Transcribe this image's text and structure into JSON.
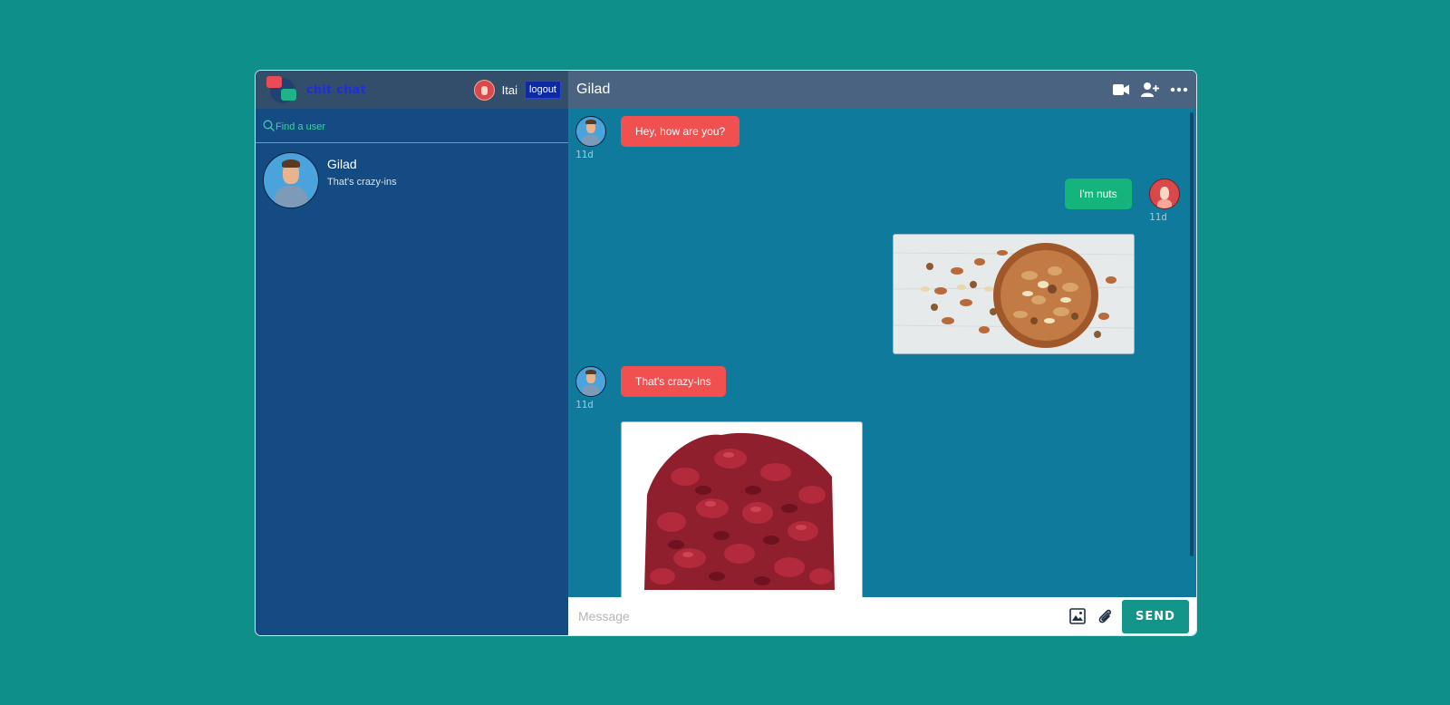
{
  "app": {
    "brand": "chit chat"
  },
  "user": {
    "name": "Itai",
    "logout_label": "logout"
  },
  "search": {
    "placeholder": "Find a user"
  },
  "contacts": [
    {
      "name": "Gilad",
      "preview": "That's crazy-ins"
    }
  ],
  "chat": {
    "title": "Gilad",
    "messages": [
      {
        "from": "them",
        "kind": "text",
        "text": "Hey, how are you?",
        "time": "11d"
      },
      {
        "from": "me",
        "kind": "text",
        "text": "I'm nuts",
        "time": "11d"
      },
      {
        "from": "me",
        "kind": "image",
        "image": "bowl-of-mixed-nuts"
      },
      {
        "from": "them",
        "kind": "text",
        "text": "That's crazy-ins",
        "time": "11d"
      },
      {
        "from": "them",
        "kind": "image",
        "image": "dried-cranberries"
      }
    ]
  },
  "composer": {
    "placeholder": "Message",
    "send_label": "SEND"
  },
  "icons": {
    "header": [
      "video-camera-icon",
      "add-user-icon",
      "more-options-icon"
    ],
    "composer": [
      "image-icon",
      "paperclip-icon"
    ]
  },
  "colors": {
    "page_background": "#0e8f89",
    "sidebar": "#134b82",
    "chat_background": "#0f7a9c",
    "bubble_them": "#f0504f",
    "bubble_me": "#15b47c",
    "send_button": "#14958a",
    "brand_text": "#1f2fd6"
  }
}
